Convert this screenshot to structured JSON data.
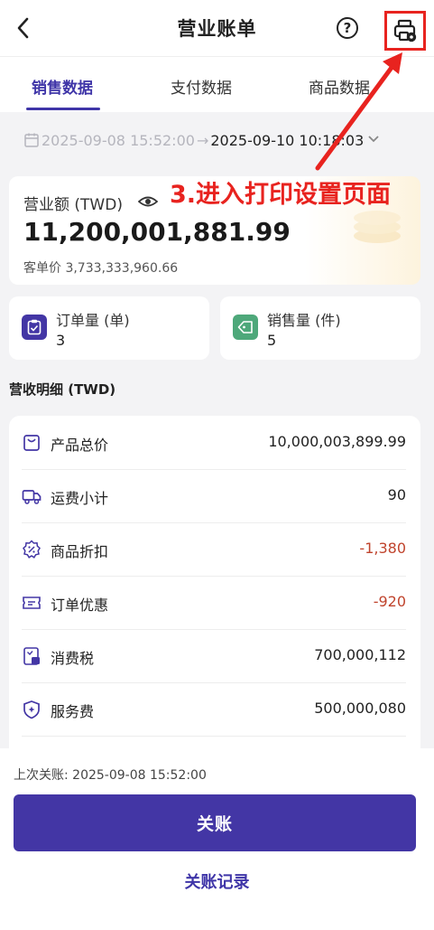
{
  "header": {
    "title": "营业账单"
  },
  "tabs": [
    {
      "label": "销售数据",
      "active": true
    },
    {
      "label": "支付数据",
      "active": false
    },
    {
      "label": "商品数据",
      "active": false
    }
  ],
  "date_range": {
    "start": "2025-09-08 15:52:00",
    "separator": "→",
    "end": "2025-09-10 10:18:03"
  },
  "revenue": {
    "label": "营业额 (TWD)",
    "amount": "11,200,001,881.99",
    "avg_label": "客单价",
    "avg_value": "3,733,333,960.66"
  },
  "annotation": {
    "text": "3.进入打印设置页面",
    "color": "#e8231f"
  },
  "stats": [
    {
      "label": "订单量 (单)",
      "value": "3",
      "icon": "clipboard-icon",
      "color": "#4336a5"
    },
    {
      "label": "销售量 (件)",
      "value": "5",
      "icon": "tag-icon",
      "color": "#4ea87a"
    }
  ],
  "details": {
    "title": "营收明细 (TWD)",
    "rows": [
      {
        "label": "产品总价",
        "value": "10,000,003,899.99",
        "icon": "product-box-icon",
        "negative": false
      },
      {
        "label": "运费小计",
        "value": "90",
        "icon": "truck-icon",
        "negative": false
      },
      {
        "label": "商品折扣",
        "value": "-1,380",
        "icon": "discount-badge-icon",
        "negative": true
      },
      {
        "label": "订单优惠",
        "value": "-920",
        "icon": "coupon-icon",
        "negative": true
      },
      {
        "label": "消费税",
        "value": "700,000,112",
        "icon": "tax-receipt-icon",
        "negative": false
      },
      {
        "label": "服务费",
        "value": "500,000,080",
        "icon": "service-shield-icon",
        "negative": false
      }
    ]
  },
  "footer": {
    "last_close_label": "上次关账:",
    "last_close_time": "2025-09-08 15:52:00",
    "close_button": "关账",
    "records_link": "关账记录"
  },
  "colors": {
    "accent": "#4336a5",
    "negative": "#c0442d",
    "annotation": "#e8231f"
  }
}
